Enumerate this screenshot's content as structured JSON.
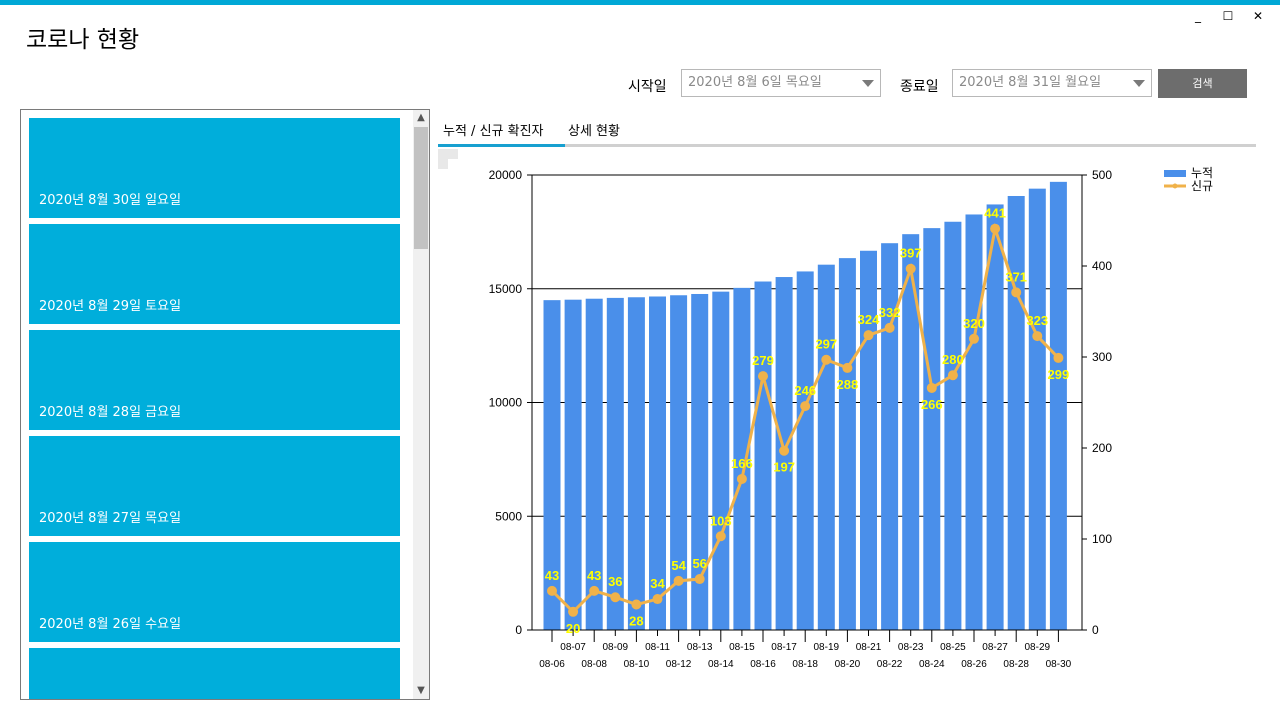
{
  "app": {
    "title": "코로나 현황"
  },
  "window_controls": {
    "minimize": "_",
    "maximize": "☐",
    "close": "✕"
  },
  "filters": {
    "start_label": "시작일",
    "start_value": "2020년 8월 6일 목요일",
    "end_label": "종료일",
    "end_value": "2020년 8월 31일 월요일",
    "search_label": "검색"
  },
  "date_list": [
    {
      "label": "2020년 8월 30일 일요일"
    },
    {
      "label": "2020년 8월 29일 토요일"
    },
    {
      "label": "2020년 8월 28일 금요일"
    },
    {
      "label": "2020년 8월 27일 목요일"
    },
    {
      "label": "2020년 8월 26일 수요일"
    },
    {
      "label": ""
    }
  ],
  "tabs": [
    {
      "label": "누적 / 신규 확진자",
      "active": true
    },
    {
      "label": "상세 현황",
      "active": false
    }
  ],
  "colors": {
    "accent": "#00aedb",
    "bar": "#4a8fea",
    "line": "#f0b24a",
    "label": "#ffff00"
  },
  "chart_data": {
    "type": "bar",
    "categories": [
      "08-06",
      "08-07",
      "08-08",
      "08-09",
      "08-10",
      "08-11",
      "08-12",
      "08-13",
      "08-14",
      "08-15",
      "08-16",
      "08-17",
      "08-18",
      "08-19",
      "08-20",
      "08-21",
      "08-22",
      "08-23",
      "08-24",
      "08-25",
      "08-26",
      "08-27",
      "08-28",
      "08-29",
      "08-30"
    ],
    "series": [
      {
        "name": "누적",
        "type": "bar",
        "axis": "left",
        "values": [
          14499,
          14519,
          14562,
          14598,
          14626,
          14660,
          14714,
          14770,
          14873,
          15039,
          15318,
          15515,
          15761,
          16058,
          16346,
          16670,
          17002,
          17399,
          17665,
          17945,
          18265,
          18706,
          19077,
          19400,
          19699
        ]
      },
      {
        "name": "신규",
        "type": "line",
        "axis": "right",
        "values": [
          43,
          20,
          43,
          36,
          28,
          34,
          54,
          56,
          103,
          166,
          279,
          197,
          246,
          297,
          288,
          324,
          332,
          397,
          266,
          280,
          320,
          441,
          371,
          323,
          299
        ]
      }
    ],
    "ylim_left": [
      0,
      20000
    ],
    "yticks_left": [
      0,
      5000,
      10000,
      15000,
      20000
    ],
    "ylim_right": [
      0,
      500
    ],
    "yticks_right": [
      0,
      100,
      200,
      300,
      400,
      500
    ],
    "grid": true,
    "legend_position": "top-right"
  }
}
